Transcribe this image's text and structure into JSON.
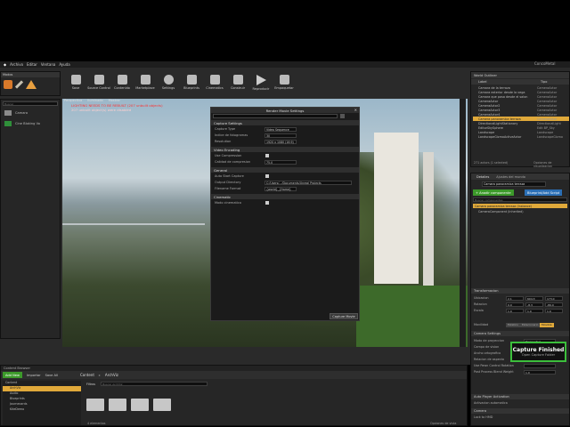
{
  "window": {
    "tab_title": "ConcoMetal"
  },
  "menu": [
    "Archivo",
    "Editar",
    "Ventana",
    "Ayuda"
  ],
  "toolbar": [
    {
      "label": "Save",
      "icon": "save-icon"
    },
    {
      "label": "Source Control",
      "icon": "source-control-icon"
    },
    {
      "label": "Contenido",
      "icon": "content-icon"
    },
    {
      "label": "Marketplace",
      "icon": "marketplace-icon"
    },
    {
      "label": "Settings",
      "icon": "settings-icon"
    },
    {
      "label": "Blueprints",
      "icon": "blueprints-icon"
    },
    {
      "label": "Cinematics",
      "icon": "cinematics-icon"
    },
    {
      "label": "Construir",
      "icon": "build-icon"
    },
    {
      "label": "Reproducir",
      "icon": "play-icon"
    },
    {
      "label": "Empaquetar",
      "icon": "launch-icon"
    }
  ],
  "modes": {
    "title": "Modos",
    "search_placeholder": "Buscar"
  },
  "place_items": [
    {
      "label": "Camara",
      "icon": "camera-icon"
    },
    {
      "label": "Cine Bloking Vo",
      "icon": "cine-icon"
    }
  ],
  "viewport": {
    "tabs": [
      "Perspectiva",
      "Iluminado",
      "Mostrar"
    ],
    "warning_line1": "LIGHTING NEEDS TO BE REBUILT (207 unbuilt objects)",
    "warning_line2": "207 unbuilt object(s) were disabled"
  },
  "render_movie": {
    "title": "Render Movie Settings",
    "search_placeholder": "Buscar",
    "sections": [
      {
        "name": "Capture Settings",
        "rows": [
          {
            "label": "Capture Type",
            "value": "Video Sequence",
            "kind": "select"
          },
          {
            "label": "Indice de fotogramas",
            "value": "30",
            "kind": "field"
          },
          {
            "label": "Resolution",
            "value": "1920 x 1080 (16:9)",
            "kind": "select"
          }
        ]
      },
      {
        "name": "Video Encoding",
        "rows": [
          {
            "label": "Use Compression",
            "value": "",
            "kind": "check"
          },
          {
            "label": "Calidad de compresion",
            "value": "75.0",
            "kind": "field"
          }
        ]
      },
      {
        "name": "General",
        "rows": [
          {
            "label": "Auto Start Capture",
            "value": "",
            "kind": "check"
          },
          {
            "label": "Output Directory",
            "value": "C:/Users/.../Documents/Unreal Projects",
            "kind": "field"
          },
          {
            "label": "Filename Format",
            "value": "{world}_{frame}",
            "kind": "field"
          }
        ]
      },
      {
        "name": "Cinematic",
        "rows": [
          {
            "label": "Modo cinematico",
            "value": "",
            "kind": "check"
          }
        ]
      }
    ],
    "capture_button": "Capture Movie"
  },
  "outliner": {
    "title": "World Outliner",
    "search_placeholder": "Buscar...",
    "col_label": "Label",
    "col_type": "Tipo",
    "rows": [
      {
        "label": "Camara de la terraza",
        "type": "CameraActor",
        "selected": false
      },
      {
        "label": "Camara exterior desde la vega",
        "type": "CameraActor",
        "selected": false
      },
      {
        "label": "Camara que pasa desde el salon",
        "type": "CameraActor",
        "selected": false
      },
      {
        "label": "CameraActor",
        "type": "CameraActor",
        "selected": false
      },
      {
        "label": "CameraActor2",
        "type": "CameraActor",
        "selected": false
      },
      {
        "label": "CameraActor3",
        "type": "CameraActor",
        "selected": false
      },
      {
        "label": "CameraActor4",
        "type": "CameraActor",
        "selected": false
      },
      {
        "label": "Camera panoramica terraza",
        "type": "CameraActor",
        "selected": true
      },
      {
        "label": "DirectionalLightStationary",
        "type": "DirectionalLight",
        "selected": false
      },
      {
        "label": "EditorSkySphere",
        "type": "Edit BP_Sky",
        "selected": false
      },
      {
        "label": "Landscape",
        "type": "Landscape",
        "selected": false
      },
      {
        "label": "LandscapeGizmoActiveActor",
        "type": "LandscapeGizmo",
        "selected": false
      }
    ],
    "footer": "271 actors (1 selected)",
    "view_options": "Opciones de visualizacion"
  },
  "details": {
    "tab1": "Detalles",
    "tab2": "Ajustes del mundo",
    "name_value": "Camara panoramica terraza",
    "add_component": "+ Anadir componente",
    "blueprint_button": "Blueprint/Add Script",
    "search_placeholder": "Buscar componentes",
    "component_root": "Camara panoramica terraza (Instance)",
    "component_child": "CameraComponent (Inherited)",
    "transform_header": "Transformacion",
    "location_label": "Ubicacion",
    "rotation_label": "Rotacion",
    "scale_label": "Escala",
    "location": [
      "2.1",
      "604.3",
      "173.0"
    ],
    "rotation": [
      "0.0",
      "-8.3",
      "-89.0"
    ],
    "scale": [
      "1.0",
      "1.0",
      "1.0"
    ],
    "mobility_label": "Movilidad",
    "mobility": [
      "Estatico",
      "Estacionario",
      "Movible"
    ],
    "camera_header": "Camera Settings",
    "camera_rows": [
      {
        "label": "Modo de proyeccion",
        "value": "Perspectiva"
      },
      {
        "label": "Campo de vision",
        "value": "90.0"
      },
      {
        "label": "Ancho ortografico",
        "value": "512.0"
      },
      {
        "label": "Relacion de aspecto",
        "value": "1.777778"
      },
      {
        "label": "Use Pawn Control Rotation",
        "value": ""
      },
      {
        "label": "Post Process Blend Weight",
        "value": "1.0"
      }
    ],
    "autoplayer_header": "Auto Player Activation",
    "autoplayer_row": "Activacion automatica",
    "camera2_header": "Camera",
    "lock_row": "Lock to HMD"
  },
  "content_browser": {
    "tab": "Content Browser",
    "add_new": "Add New",
    "import": "Importar",
    "save_all": "Save All",
    "path": [
      "Content",
      "ArchViz"
    ],
    "filters": "Filtros",
    "search_placeholder": "Buscar ArchViz",
    "tree": [
      "Content",
      "ArchViz",
      "Audio",
      "Blueprints",
      "Journecards",
      "KiteDemo"
    ],
    "footer": "4 elementos",
    "view_options": "Opciones de vista"
  },
  "toast": {
    "title": "Capture Finished",
    "link": "Open Capture Folder"
  }
}
